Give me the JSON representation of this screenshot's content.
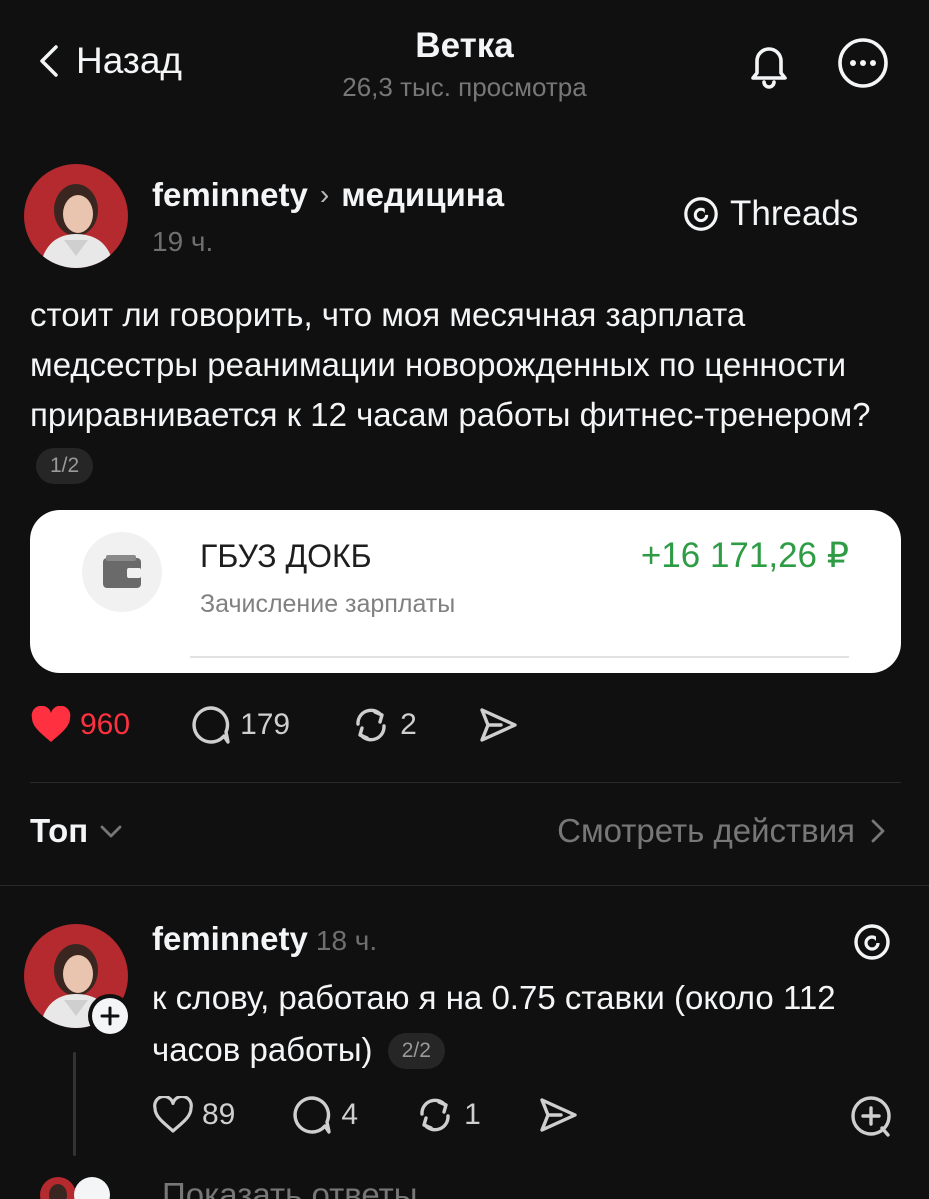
{
  "header": {
    "back_label": "Назад",
    "title": "Ветка",
    "views": "26,3 тыс. просмотра"
  },
  "post": {
    "author": "feminnety",
    "topic": "медицина",
    "time": "19 ч.",
    "badge": "Threads",
    "text": "стоит ли говорить, что моя месячная зарплата медсестры реанимации новорожденных по ценности приравнивается к 12 часам работы фитнес-тренером?",
    "pager": "1/2",
    "card": {
      "name": "ГБУЗ ДОКБ",
      "description": "Зачисление зарплаты",
      "amount": "+16 171,26 ₽",
      "amount_color": "#2e9b45"
    },
    "likes": "960",
    "comments": "179",
    "reposts": "2",
    "like_color": "#ff3040"
  },
  "sort": {
    "label": "Топ",
    "view_activity": "Смотреть действия"
  },
  "reply": {
    "author": "feminnety",
    "time": "18 ч.",
    "text": "к слову, работаю я на 0.75 ставки (около 112 часов работы)",
    "pager": "2/2",
    "likes": "89",
    "comments": "4",
    "reposts": "1"
  },
  "show_replies": "Показать ответы",
  "icons": {
    "back": "chevron-left-icon",
    "bell": "bell-icon",
    "more": "more-icon",
    "threads": "threads-logo-icon",
    "heart": "heart-icon",
    "comment": "comment-icon",
    "repost": "repost-icon",
    "share": "send-icon",
    "wallet": "wallet-icon",
    "add": "add-comment-icon"
  }
}
